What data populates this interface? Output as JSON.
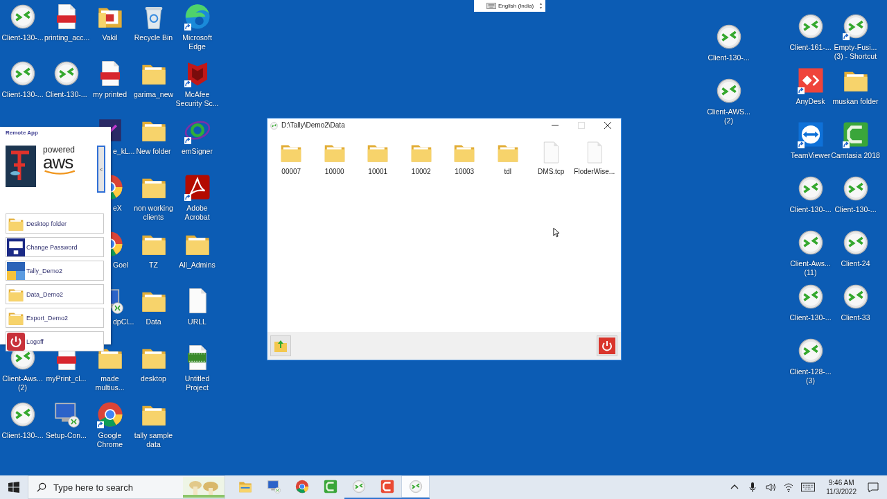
{
  "language_bar": {
    "label": "English (India)"
  },
  "left_desktop": {
    "columns": [
      {
        "icons": [
          {
            "kind": "rdp",
            "label": "Client-130-...",
            "shortcut": false
          },
          {
            "kind": "rdp",
            "label": "Client-130-...",
            "shortcut": false
          },
          {
            "kind": "covered"
          },
          {
            "kind": "covered"
          },
          {
            "kind": "covered"
          },
          {
            "kind": "covered"
          },
          {
            "kind": "rdp",
            "label": "Client-Aws... (2)",
            "shortcut": false
          },
          {
            "kind": "rdp",
            "label": "Client-130-...",
            "shortcut": false
          }
        ]
      },
      {
        "icons": [
          {
            "kind": "pdf",
            "label": "printing_acc...",
            "shortcut": false
          },
          {
            "kind": "rdp",
            "label": "Client-130-...",
            "shortcut": false
          },
          {
            "kind": "covered"
          },
          {
            "kind": "covered"
          },
          {
            "kind": "covered"
          },
          {
            "kind": "covered"
          },
          {
            "kind": "pdf",
            "label": "myPrint_cl...",
            "shortcut": false
          },
          {
            "kind": "setup",
            "label": "Setup-Con...",
            "shortcut": false
          }
        ]
      },
      {
        "icons": [
          {
            "kind": "vakil",
            "label": "Vakil",
            "shortcut": false
          },
          {
            "kind": "pdf",
            "label": "my printed",
            "shortcut": false
          },
          {
            "kind": "darkapp",
            "label": "e_kL...",
            "shortcut": false,
            "partial": true
          },
          {
            "kind": "chrome",
            "label": "eX",
            "shortcut": false,
            "partial": true
          },
          {
            "kind": "chrome",
            "label": "Goel",
            "shortcut": false,
            "partial": true
          },
          {
            "kind": "setup",
            "label": "dpCl...",
            "shortcut": false,
            "partial": true
          },
          {
            "kind": "folder",
            "label": "made multius...",
            "shortcut": false
          },
          {
            "kind": "chrome",
            "label": "Google Chrome",
            "shortcut": true
          }
        ]
      },
      {
        "icons": [
          {
            "kind": "recycle",
            "label": "Recycle Bin",
            "shortcut": false
          },
          {
            "kind": "folder",
            "label": "garima_new",
            "shortcut": false
          },
          {
            "kind": "folder",
            "label": "New folder",
            "shortcut": false
          },
          {
            "kind": "folder",
            "label": "non working clients",
            "shortcut": false
          },
          {
            "kind": "folder",
            "label": "TZ",
            "shortcut": false
          },
          {
            "kind": "folder",
            "label": "Data",
            "shortcut": false
          },
          {
            "kind": "folder",
            "label": "desktop",
            "shortcut": false
          },
          {
            "kind": "folder",
            "label": "tally sample data",
            "shortcut": false
          }
        ]
      },
      {
        "icons": [
          {
            "kind": "edge",
            "label": "Microsoft Edge",
            "shortcut": true
          },
          {
            "kind": "mcafee",
            "label": "McAfee Security Sc...",
            "shortcut": true
          },
          {
            "kind": "emsigner",
            "label": "emSigner",
            "shortcut": true
          },
          {
            "kind": "acrobat",
            "label": "Adobe Acrobat",
            "shortcut": true
          },
          {
            "kind": "folder",
            "label": "All_Admins",
            "shortcut": false
          },
          {
            "kind": "file",
            "label": "URLL",
            "shortcut": false
          },
          {
            "kind": "camproj",
            "label": "Untitled Project",
            "shortcut": false
          }
        ]
      }
    ]
  },
  "right_desktop": {
    "columns": [
      {
        "icons": [
          {
            "kind": "rdp",
            "label": "Client-130-...",
            "shortcut": false
          },
          {
            "kind": "rdp",
            "label": "Client-AWS... (2)",
            "shortcut": false
          }
        ]
      },
      {
        "icons": [
          {
            "kind": "rdp",
            "label": "Client-161-...",
            "shortcut": false
          },
          {
            "kind": "anydesk",
            "label": "AnyDesk",
            "shortcut": true
          },
          {
            "kind": "teamviewer",
            "label": "TeamViewer",
            "shortcut": true
          },
          {
            "kind": "rdp",
            "label": "Client-130-...",
            "shortcut": false
          },
          {
            "kind": "rdp",
            "label": "Client-Aws... (11)",
            "shortcut": false
          },
          {
            "kind": "rdp",
            "label": "Client-130-...",
            "shortcut": false
          },
          {
            "kind": "rdp",
            "label": "Client-128-... (3)",
            "shortcut": false
          }
        ]
      },
      {
        "icons": [
          {
            "kind": "rdp",
            "label": "Empty-Fusi... (3) - Shortcut",
            "shortcut": true
          },
          {
            "kind": "folder",
            "label": "muskan folder",
            "shortcut": false
          },
          {
            "kind": "camtasia",
            "label": "Camtasia 2018",
            "shortcut": true
          },
          {
            "kind": "rdp",
            "label": "Client-130-...",
            "shortcut": false
          },
          {
            "kind": "rdp",
            "label": "Client-24",
            "shortcut": false
          },
          {
            "kind": "rdp",
            "label": "Client-33",
            "shortcut": false
          }
        ]
      }
    ]
  },
  "remote_app": {
    "title": "Remote App",
    "logo_top": "powered",
    "logo_bottom": "aws",
    "collapse_label": "<",
    "items": [
      {
        "kind": "folder",
        "label": "Desktop folder"
      },
      {
        "kind": "cad",
        "label": "Change Password"
      },
      {
        "kind": "tiles",
        "label": "Tally_Demo2"
      },
      {
        "kind": "folder",
        "label": "Data_Demo2"
      },
      {
        "kind": "folder",
        "label": "Export_Demo2"
      },
      {
        "kind": "power",
        "label": "Logoff"
      }
    ]
  },
  "explorer": {
    "title": "D:\\Tally\\Demo2\\Data",
    "maximize_disabled": true,
    "items": [
      {
        "kind": "folder",
        "label": "00007"
      },
      {
        "kind": "folder",
        "label": "10000"
      },
      {
        "kind": "folder",
        "label": "10001"
      },
      {
        "kind": "folder",
        "label": "10002"
      },
      {
        "kind": "folder",
        "label": "10003"
      },
      {
        "kind": "folder",
        "label": "tdl"
      },
      {
        "kind": "file",
        "label": "DMS.tcp"
      },
      {
        "kind": "file",
        "label": "FloderWise..."
      }
    ]
  },
  "taskbar": {
    "search": {
      "placeholder": "Type here to search"
    },
    "apps": [
      {
        "kind": "explorer",
        "running": false,
        "selected": false
      },
      {
        "kind": "setup",
        "running": false,
        "selected": false
      },
      {
        "kind": "chrome",
        "running": false,
        "selected": false
      },
      {
        "kind": "camtasia",
        "running": false,
        "selected": false
      },
      {
        "kind": "rdp",
        "running": true,
        "selected": false
      },
      {
        "kind": "camred",
        "running": true,
        "selected": false
      },
      {
        "kind": "rdp",
        "running": true,
        "selected": true
      }
    ],
    "time": "9:46 AM",
    "date": "11/3/2022"
  }
}
